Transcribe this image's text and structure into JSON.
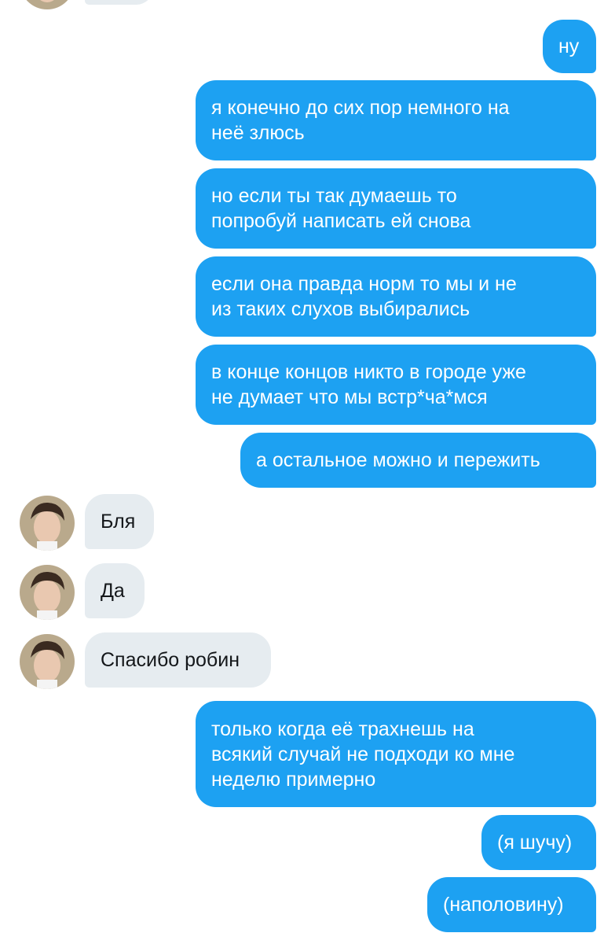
{
  "colors": {
    "outgoing_bubble": "#1DA1F2",
    "incoming_bubble": "#E6ECF0",
    "outgoing_text": "#FFFFFF",
    "incoming_text": "#14171A"
  },
  "messages": [
    {
      "direction": "out",
      "text": "ну"
    },
    {
      "direction": "out",
      "text": "я конечно до сих пор немного на\nнеё злюсь"
    },
    {
      "direction": "out",
      "text": "но если ты так думаешь то\nпопробуй написать ей снова"
    },
    {
      "direction": "out",
      "text": "если она правда норм то мы и не\nиз таких слухов выбирались"
    },
    {
      "direction": "out",
      "text": "в конце концов никто в городе уже\nне думает что мы встр*ча*мся"
    },
    {
      "direction": "out",
      "text": "а остальное можно и пережить"
    },
    {
      "direction": "in",
      "text": "Бля"
    },
    {
      "direction": "in",
      "text": "Да"
    },
    {
      "direction": "in",
      "text": "Спасибо робин"
    },
    {
      "direction": "out",
      "text": "только когда её трахнешь на\nвсякий случай не подходи ко мне\nнеделю примерно"
    },
    {
      "direction": "out",
      "text": "(я шучу)"
    },
    {
      "direction": "out",
      "text": "(наполовину)"
    }
  ]
}
